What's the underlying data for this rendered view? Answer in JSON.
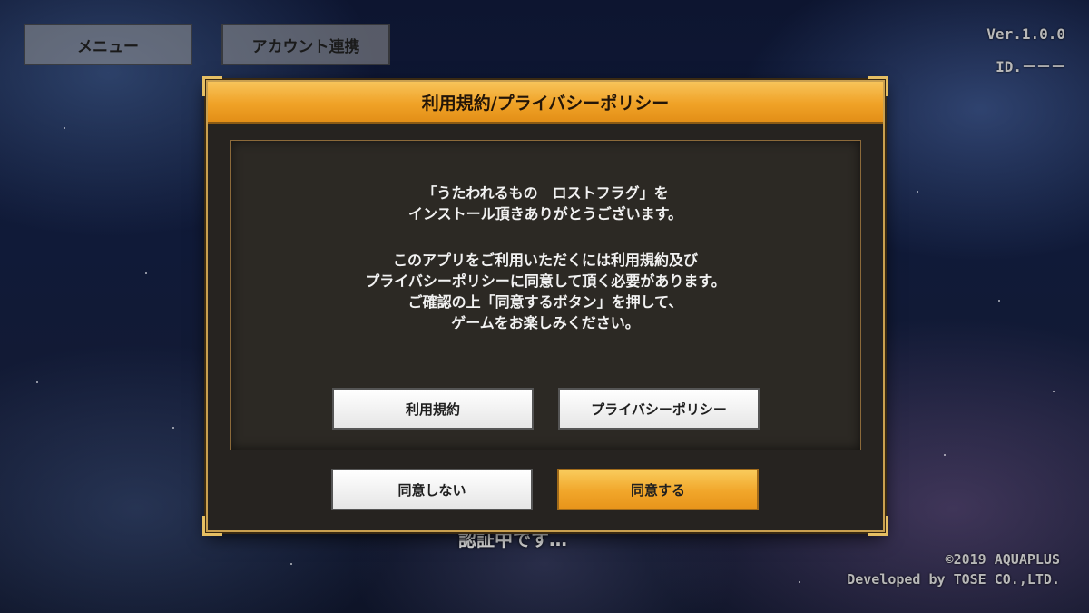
{
  "top_bar": {
    "menu_label": "メニュー",
    "account_label": "アカウント連携",
    "version": "Ver.1.0.0",
    "user_id": "ID.－－－"
  },
  "dialog": {
    "title": "利用規約/プライバシーポリシー",
    "message_1_line_1": "「うたわれるもの　ロストフラグ」を",
    "message_1_line_2": "インストール頂きありがとうございます。",
    "message_2_line_1": "このアプリをご利用いただくには利用規約及び",
    "message_2_line_2": "プライバシーポリシーに同意して頂く必要があります。",
    "message_2_line_3": "ご確認の上「同意するボタン」を押して、",
    "message_2_line_4": "ゲームをお楽しみください。",
    "terms_button": "利用規約",
    "privacy_button": "プライバシーポリシー",
    "disagree_button": "同意しない",
    "agree_button": "同意する"
  },
  "footer": {
    "loading_text": "認証中です…",
    "copyright": "©2019 AQUAPLUS",
    "developer": "Developed by TOSE CO.,LTD."
  },
  "colors": {
    "accent_gold": "#f0a227",
    "dialog_bg": "#262320",
    "frame_gold": "#c9a050"
  }
}
